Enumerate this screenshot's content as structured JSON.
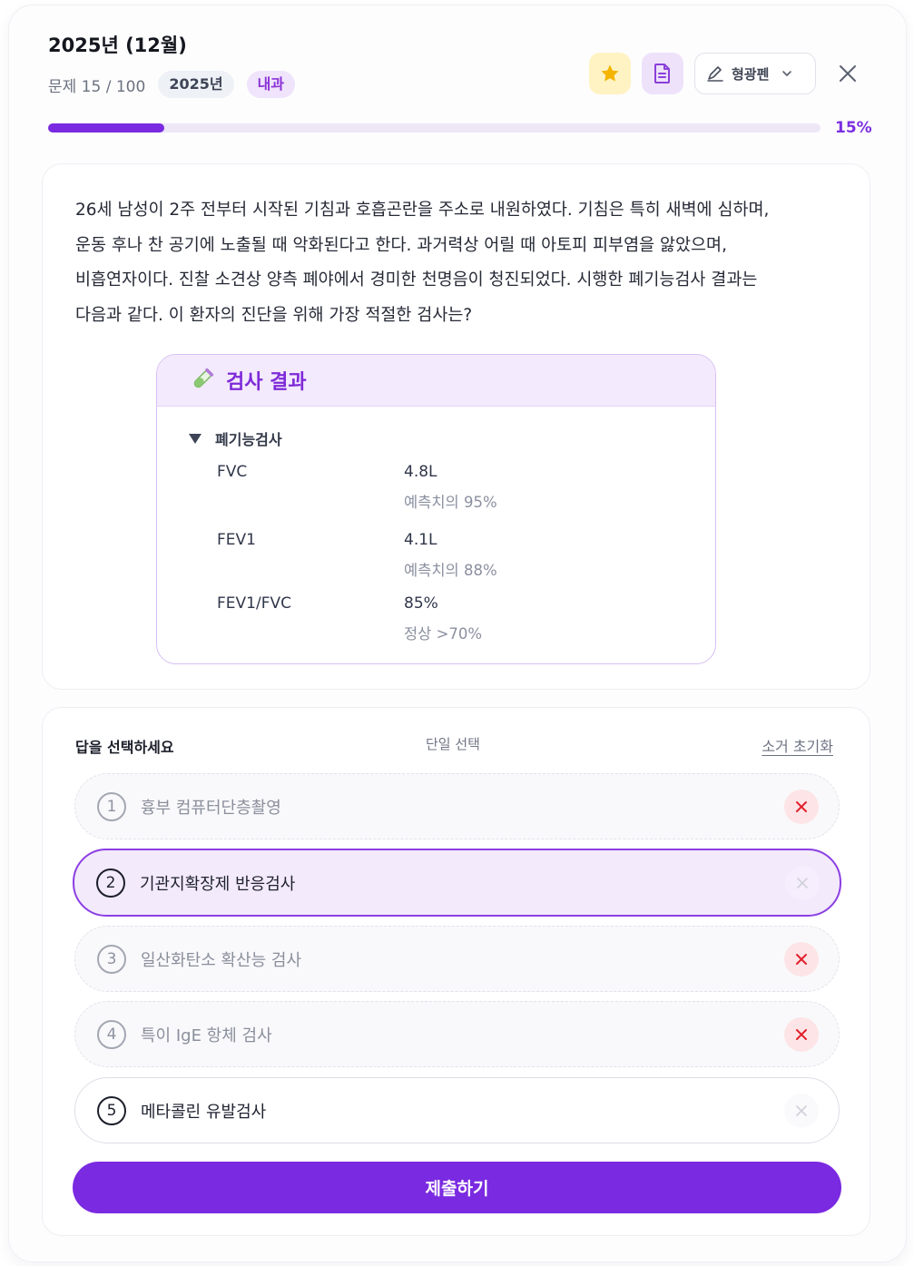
{
  "header": {
    "title": "2025년 (12월)",
    "counter": "문제 15 / 100",
    "tag_year": "2025년",
    "tag_subject": "내과",
    "pen_label": "형광펜",
    "progress_label": "15%",
    "progress_fraction": 0.15
  },
  "question": {
    "lines": [
      "26세 남성이 2주 전부터 시작된 기침과 호흡곤란을 주소로 내원하였다. 기침은 특히 새벽에 심하며,",
      "운동 후나 찬 공기에 노출될 때 악화된다고 한다. 과거력상 어릴 때 아토피 피부염을 앓았으며,",
      "비흡연자이다. 진찰 소견상 양측 폐야에서 경미한 천명음이 청진되었다. 시행한 폐기능검사 결과는",
      "다음과 같다. 이 환자의 진단을 위해 가장 적절한 검사는?"
    ]
  },
  "lab": {
    "title": "검사 결과",
    "section": "폐기능검사",
    "rows": [
      {
        "name": "FVC",
        "value": "4.8L",
        "ref": "예측치의 95%"
      },
      {
        "name": "FEV1",
        "value": "4.1L",
        "ref": "예측치의 88%"
      },
      {
        "name": "FEV1/FVC",
        "value": "85%",
        "ref": "정상 >70%"
      }
    ]
  },
  "answers": {
    "prompt": "답을 선택하세요",
    "mode": "단일 선택",
    "reset": "소거 초기화",
    "options": [
      {
        "num": "1",
        "text": "흉부 컴퓨터단층촬영",
        "state": "eliminated"
      },
      {
        "num": "2",
        "text": "기관지확장제 반응검사",
        "state": "selected"
      },
      {
        "num": "3",
        "text": "일산화탄소 확산능 검사",
        "state": "eliminated"
      },
      {
        "num": "4",
        "text": "특이 IgE 항체 검사",
        "state": "eliminated"
      },
      {
        "num": "5",
        "text": "메타콜린 유발검사",
        "state": "normal"
      }
    ],
    "submit": "제출하기"
  },
  "colors": {
    "accent": "#7a2ae0",
    "star": "#f5b400",
    "strike_red": "#e0202c"
  },
  "icons": [
    "star-icon",
    "memo-icon",
    "highlighter-icon",
    "chevron-down-icon",
    "close-icon",
    "test-tube-icon",
    "triangle-down-icon",
    "x-icon"
  ]
}
